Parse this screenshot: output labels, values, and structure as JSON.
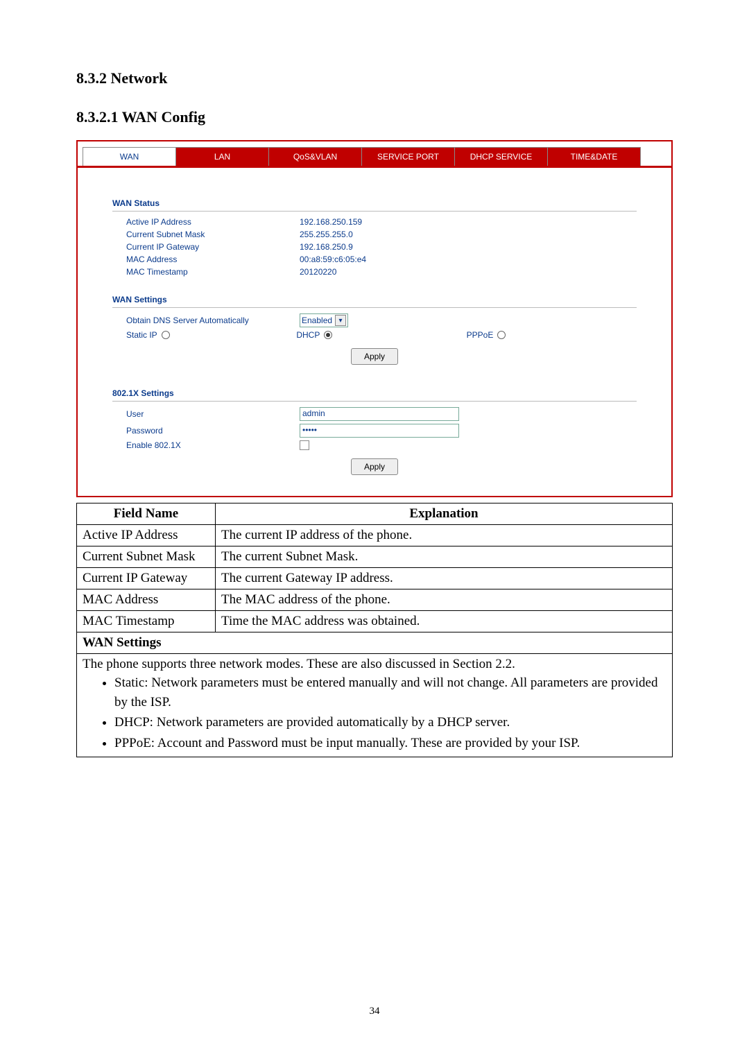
{
  "headings": {
    "h2": "8.3.2    Network",
    "h3": "8.3.2.1   WAN Config"
  },
  "tabs": [
    "WAN",
    "LAN",
    "QoS&VLAN",
    "SERVICE PORT",
    "DHCP SERVICE",
    "TIME&DATE"
  ],
  "wan_status": {
    "title": "WAN Status",
    "items": [
      {
        "label": "Active IP Address",
        "value": "192.168.250.159"
      },
      {
        "label": "Current Subnet Mask",
        "value": "255.255.255.0"
      },
      {
        "label": "Current IP Gateway",
        "value": "192.168.250.9"
      },
      {
        "label": "MAC Address",
        "value": "00:a8:59:c6:05:e4"
      },
      {
        "label": "MAC Timestamp",
        "value": "20120220"
      }
    ]
  },
  "wan_settings": {
    "title": "WAN Settings",
    "dns_label": "Obtain DNS Server Automatically",
    "dns_value": "Enabled",
    "radios": {
      "static": "Static IP",
      "dhcp": "DHCP",
      "pppoe": "PPPoE",
      "selected": "dhcp"
    },
    "apply": "Apply"
  },
  "dot1x": {
    "title": "802.1X Settings",
    "user_label": "User",
    "user_value": "admin",
    "pass_label": "Password",
    "pass_value": "•••••",
    "enable_label": "Enable 802.1X",
    "apply": "Apply"
  },
  "doc_table": {
    "headers": [
      "Field Name",
      "Explanation"
    ],
    "rows": [
      [
        "Active IP Address",
        "The current IP address of the phone."
      ],
      [
        "Current Subnet Mask",
        "The current Subnet Mask."
      ],
      [
        "Current IP Gateway",
        "The current Gateway IP address."
      ],
      [
        "MAC Address",
        "The MAC address of the phone."
      ],
      [
        "MAC Timestamp",
        "Time the MAC address was obtained."
      ]
    ],
    "inner_header": "WAN Settings",
    "intro": "The phone supports three network modes.   These are also discussed in Section 2.2.",
    "bullets": [
      "Static: Network parameters must be entered manually and will not change.   All parameters are provided by the ISP.",
      "DHCP: Network parameters are provided automatically by a DHCP server.",
      "PPPoE: Account and Password must be input manually.   These are provided by your ISP."
    ]
  },
  "page_number": "34"
}
